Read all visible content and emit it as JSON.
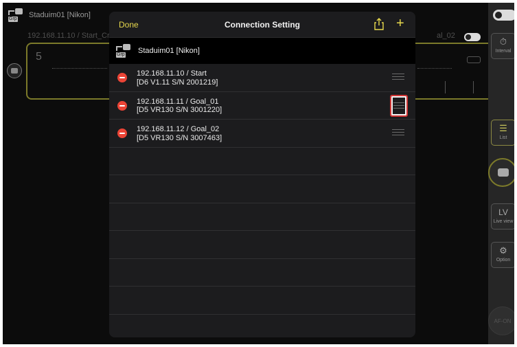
{
  "background": {
    "group_title": "Staduim01 [Nikon]",
    "camera_ip_label": "192.168.11.10 / Start_Cr",
    "goal_label": "al_02",
    "dial_number": "5"
  },
  "sidebar": {
    "interval_label": "Interval",
    "list_label": "List",
    "lv_icon": "LV",
    "lv_label": "Live view",
    "option_label": "Option",
    "af_label": "AF-ON"
  },
  "modal": {
    "done_label": "Done",
    "title": "Connection Setting",
    "add_icon": "+",
    "group_label": "Staduim01 [Nikon]",
    "grp_badge": "Grp",
    "rows": [
      {
        "line1": "192.168.11.10 / Start",
        "line2": "[D6  V1.11  S/N 2001219]"
      },
      {
        "line1": "192.168.11.11 / Goal_01",
        "line2": "[D5  VR130  S/N 3001220]"
      },
      {
        "line1": "192.168.11.12 / Goal_02",
        "line2": "[D5  VR130  S/N 3007463]"
      }
    ]
  },
  "colors": {
    "accent": "#e8d94d",
    "delete": "#eb4436",
    "highlight": "#d03434"
  }
}
